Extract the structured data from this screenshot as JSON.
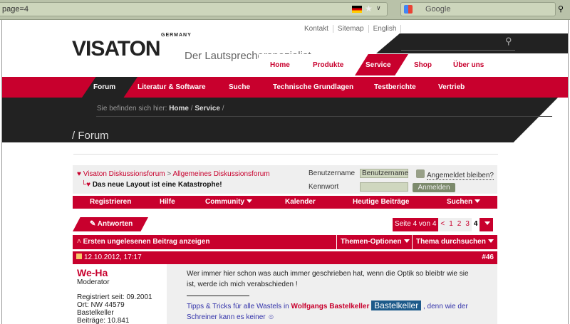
{
  "browser": {
    "url": "page=4",
    "search_placeholder": "Google"
  },
  "header": {
    "top_links": [
      "Kontakt",
      "Sitemap",
      "English"
    ],
    "logo": "VISATON",
    "logo_sub": "GERMANY",
    "tagline": "Der Lautsprecherspezialist",
    "main_nav": [
      "Home",
      "Produkte",
      "Service",
      "Shop",
      "Über uns"
    ],
    "sub_nav": [
      "Forum",
      "Literatur & Software",
      "Suche",
      "Technische Grundlagen",
      "Testberichte",
      "Vertrieb"
    ],
    "breadcrumb_prefix": "Sie befinden sich hier:",
    "breadcrumb": [
      "Home",
      "Service"
    ],
    "page_title": "/ Forum"
  },
  "forum": {
    "crumb_root": "Visaton Diskussionsforum",
    "crumb_sep": ">",
    "crumb_sub": "Allgemeines Diskussionsforum",
    "thread_title": "Das neue Layout ist eine Katastrophe!",
    "login": {
      "username_label": "Benutzername",
      "username_value": "Benutzername",
      "password_label": "Kennwort",
      "remember": "Angemeldet bleiben?",
      "submit": "Anmelden"
    },
    "nav": [
      "Registrieren",
      "Hilfe",
      "Community",
      "Kalender",
      "Heutige Beiträge",
      "Suchen"
    ],
    "reply": "Antworten",
    "pager": {
      "label": "Seite 4 von 4",
      "prev": "<",
      "pages": [
        "1",
        "2",
        "3",
        "4"
      ],
      "current": "4"
    },
    "toolbar": {
      "first_unread": "Ersten ungelesenen Beitrag anzeigen",
      "options": "Themen-Optionen",
      "search": "Thema durchsuchen"
    },
    "post": {
      "date": "12.10.2012, 17:17",
      "number": "#46",
      "user": "We-Ha",
      "role": "Moderator",
      "registered": "Registriert seit: 09.2001",
      "location": "Ort: NW 44579 Bastelkeller",
      "posts": "Beiträge: 10.841",
      "text": "Wer immer hier schon was auch immer geschrieben hat, wenn die Optik so bleibtr wie sie ist, werde ich mich verabschieden !",
      "sig_prefix": "Tipps & Tricks für alle Wastels in",
      "sig_link": "Wolfgangs Bastelkeller",
      "sig_banner": "Bastelkeller",
      "sig_suffix": ", denn wie der Schreiner kann es keiner"
    }
  }
}
